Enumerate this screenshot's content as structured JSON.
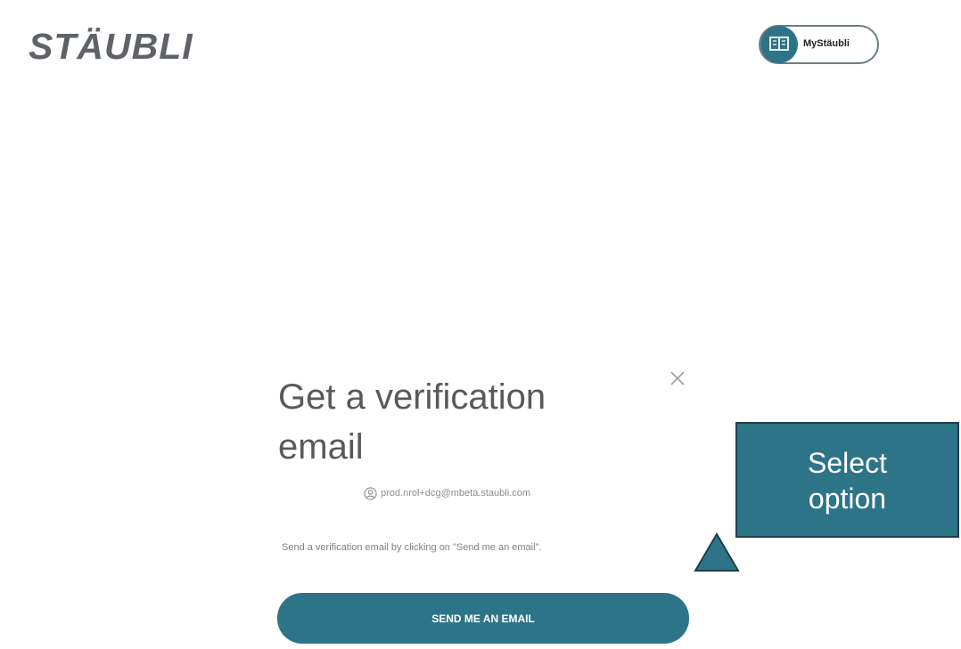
{
  "header": {
    "logo_text": "STÄUBLI",
    "account_button_label": "MyStäubli",
    "account_icon": "book-icon"
  },
  "dialog": {
    "title": "Get a verification email",
    "close_icon": "close-icon",
    "user_icon": "user-circle-icon",
    "user_email": "prod.nrol+dcg@mbeta.staubli.com",
    "instruction": "Send a verification email by clicking on \"Send me an email\".",
    "send_button_label": "SEND ME AN EMAIL"
  },
  "callout": {
    "text_line1": "Select",
    "text_line2": "option",
    "color": "#2e7488"
  },
  "colors": {
    "accent": "#2e7488",
    "logo": "#5f6367"
  }
}
